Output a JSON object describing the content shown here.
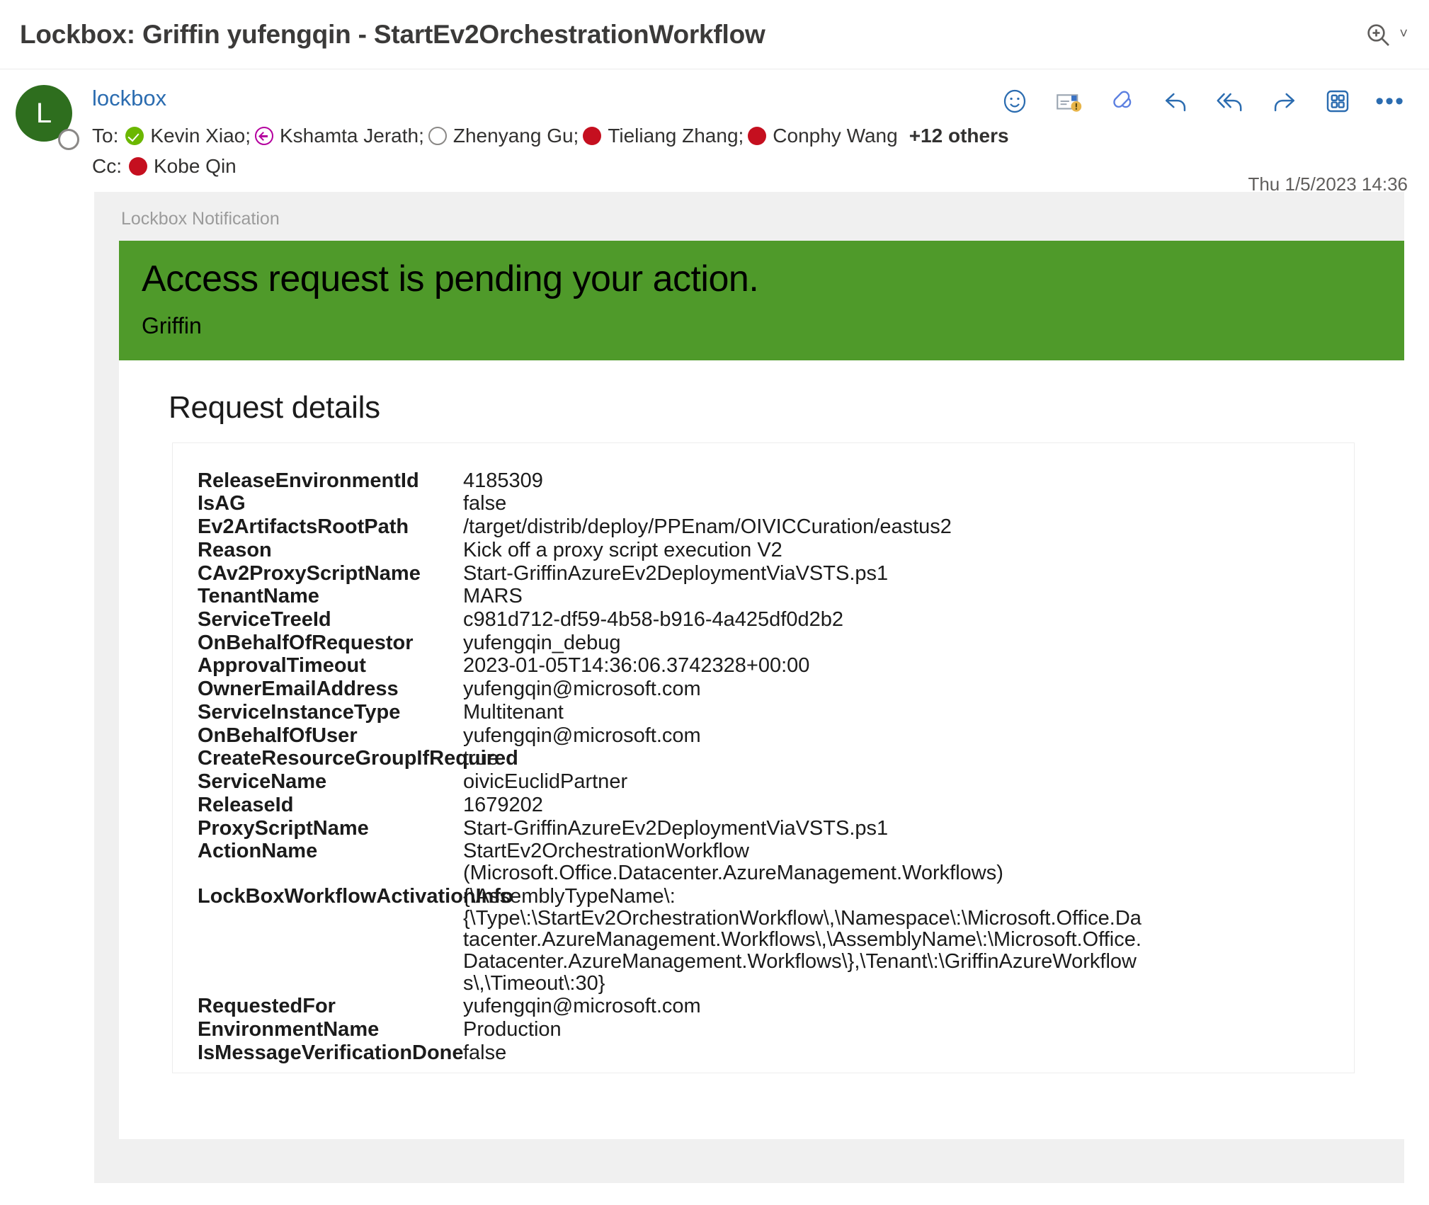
{
  "subject": {
    "text": "Lockbox: Griffin yufengqin - StartEv2OrchestrationWorkflow",
    "zoom_icon": "zoom-search-icon",
    "chevron": "˅"
  },
  "message": {
    "avatar_initial": "L",
    "avatar_color": "#2e6e1e",
    "sender": "lockbox",
    "date": "Thu 1/5/2023 14:36",
    "to_label": "To:",
    "cc_label": "Cc:",
    "to": [
      {
        "name": "Kevin Xiao;",
        "presence": "available"
      },
      {
        "name": "Kshamta Jerath;",
        "presence": "out-of-office"
      },
      {
        "name": "Zhenyang Gu;",
        "presence": "offline"
      },
      {
        "name": "Tieliang Zhang;",
        "presence": "busy"
      },
      {
        "name": "Conphy Wang",
        "presence": "busy"
      }
    ],
    "others": "+12 others",
    "cc": [
      {
        "name": "Kobe Qin",
        "presence": "busy"
      }
    ],
    "toolbar": [
      {
        "name": "react-emoji-icon",
        "label": "React"
      },
      {
        "name": "report-message-icon",
        "label": "Report message"
      },
      {
        "name": "loop-components-icon",
        "label": "Loop"
      },
      {
        "name": "reply-icon",
        "label": "Reply"
      },
      {
        "name": "reply-all-icon",
        "label": "Reply all"
      },
      {
        "name": "forward-icon",
        "label": "Forward"
      },
      {
        "name": "apps-grid-icon",
        "label": "Apps"
      },
      {
        "name": "more-options-icon",
        "label": "•••"
      }
    ]
  },
  "body": {
    "notification_label": "Lockbox Notification",
    "banner": {
      "color": "#4f9a2a",
      "title": "Access request is pending your action.",
      "subtitle": "Griffin"
    },
    "details_title": "Request details",
    "details": [
      {
        "key": "ReleaseEnvironmentId",
        "value": "4185309"
      },
      {
        "key": "IsAG",
        "value": "false"
      },
      {
        "key": "Ev2ArtifactsRootPath",
        "value": "/target/distrib/deploy/PPEnam/OIVICCuration/eastus2"
      },
      {
        "key": "Reason",
        "value": "Kick off a proxy script execution V2"
      },
      {
        "key": "CAv2ProxyScriptName",
        "value": "Start-GriffinAzureEv2DeploymentViaVSTS.ps1"
      },
      {
        "key": "TenantName",
        "value": "MARS"
      },
      {
        "key": "ServiceTreeId",
        "value": "c981d712-df59-4b58-b916-4a425df0d2b2"
      },
      {
        "key": "OnBehalfOfRequestor",
        "value": "yufengqin_debug"
      },
      {
        "key": "ApprovalTimeout",
        "value": "2023-01-05T14:36:06.3742328+00:00"
      },
      {
        "key": "OwnerEmailAddress",
        "value": "yufengqin@microsoft.com"
      },
      {
        "key": "ServiceInstanceType",
        "value": "Multitenant"
      },
      {
        "key": "OnBehalfOfUser",
        "value": "yufengqin@microsoft.com"
      },
      {
        "key": "CreateResourceGroupIfRequired",
        "value": "true"
      },
      {
        "key": "ServiceName",
        "value": "oivicEuclidPartner"
      },
      {
        "key": "ReleaseId",
        "value": "1679202"
      },
      {
        "key": "ProxyScriptName",
        "value": "Start-GriffinAzureEv2DeploymentViaVSTS.ps1"
      },
      {
        "key": "ActionName",
        "value": "StartEv2OrchestrationWorkflow (Microsoft.Office.Datacenter.AzureManagement.Workflows)"
      },
      {
        "key": "LockBoxWorkflowActivationInfo",
        "value": "{\\AssemblyTypeName\\:{\\Type\\:\\StartEv2OrchestrationWorkflow\\,\\Namespace\\:\\Microsoft.Office.Datacenter.AzureManagement.Workflows\\,\\AssemblyName\\:\\Microsoft.Office.Datacenter.AzureManagement.Workflows\\},\\Tenant\\:\\GriffinAzureWorkflows\\,\\Timeout\\:30}"
      },
      {
        "key": "RequestedFor",
        "value": "yufengqin@microsoft.com"
      },
      {
        "key": "EnvironmentName",
        "value": "Production"
      },
      {
        "key": "IsMessageVerificationDone",
        "value": "false"
      }
    ]
  }
}
